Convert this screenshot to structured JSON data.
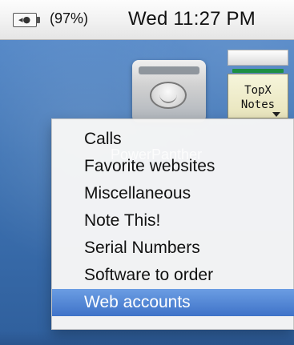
{
  "menubar": {
    "battery_text": "(97%)",
    "clock_text": "Wed 11:27 PM",
    "battery_icon": "battery-icon",
    "plug_icon": "plug-icon"
  },
  "desktop": {
    "hard_disk_icon": "hard-drive-icon",
    "notes_icon": {
      "name": "topx-notes-icon",
      "line1": "TopX",
      "line2": "Notes"
    }
  },
  "menu": {
    "watermark": "PowerPanther",
    "items": [
      {
        "label": "Calls"
      },
      {
        "label": "Favorite websites"
      },
      {
        "label": "Miscellaneous"
      },
      {
        "label": "Note This!"
      },
      {
        "label": "Serial Numbers"
      },
      {
        "label": "Software to order"
      },
      {
        "label": "Web accounts"
      }
    ],
    "selected_label": "Web accounts"
  },
  "colors": {
    "desktop_top": "#5f91cf",
    "desktop_bottom": "#2f5f9c",
    "menu_background": "#f5f5f5",
    "selection_top": "#6b9de3",
    "selection_bottom": "#3f73c8",
    "notes_stripe": "#1d8f44"
  }
}
